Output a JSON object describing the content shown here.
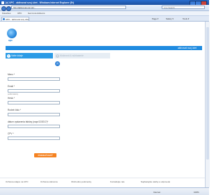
{
  "window": {
    "title": "[e] UPC - aktivovat svoj účet - Windows Internet Explorer (Er)"
  },
  "address": {
    "url": "http://aktivovat.upc.sk/..."
  },
  "search": {
    "placeholder": "Live Search"
  },
  "favorites": {
    "label": "Favorites",
    "items": [
      "UPC",
      "Get more Add-ons"
    ]
  },
  "tab": {
    "label": "UPC - aktivovat svoj účet"
  },
  "commandbar": {
    "items": [
      "Page ▾",
      "Safety ▾",
      "Tools ▾"
    ]
  },
  "brand": {
    "name": "upc"
  },
  "strip": {
    "title": "aktivovat svoj účet"
  },
  "steps": [
    {
      "num": "1",
      "label": "Vaše údaje"
    },
    {
      "num": "2",
      "label": "Možnosti & súhlasenie"
    }
  ],
  "pager": {
    "label": "(i)"
  },
  "form": {
    "fields": [
      {
        "label": "Meno *",
        "hint": ""
      },
      {
        "label": "Email *",
        "hint": "podľa faktúry"
      },
      {
        "label": "Heslo *",
        "hint": ""
      },
      {
        "label": "Rodné číslo *",
        "hint": ""
      },
      {
        "label": "dátum vystavenia faktúry (napr.02/2017)*",
        "hint": ""
      },
      {
        "label": "CPV *",
        "hint": ""
      }
    ],
    "submit": "POKRAČOVAŤ"
  },
  "footer": {
    "links": [
      "Ochrana údajov na UPC",
      "Ochrana súkromia",
      "Obchodné podmienky",
      "Kontaktujte nás",
      "Najčastejšie otázky a odpovede"
    ]
  },
  "status": {
    "zone": "Internet",
    "zoom": "100%"
  }
}
